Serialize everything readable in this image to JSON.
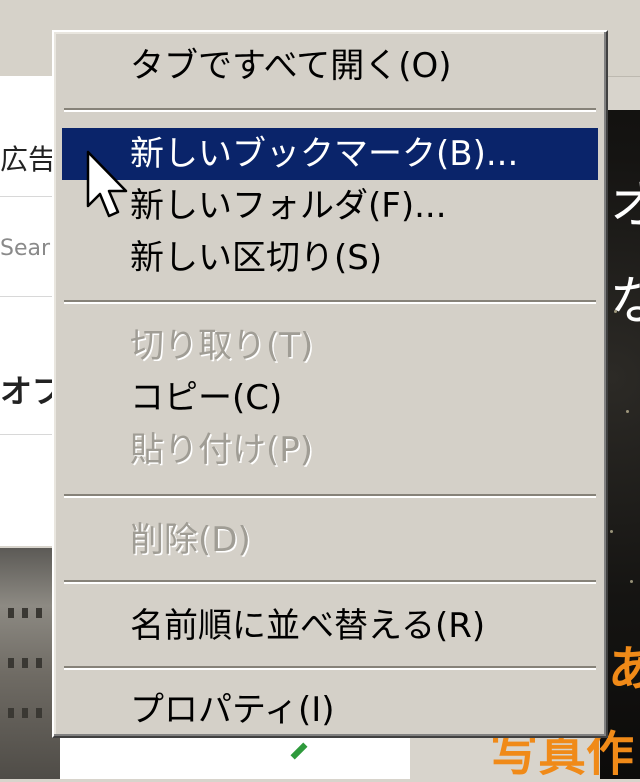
{
  "background": {
    "left_texts": [
      "広告は",
      "Sear",
      "オプ"
    ],
    "right_texts_white": [
      "オ",
      "な"
    ],
    "right_texts_orange": [
      "あ",
      "写真作"
    ]
  },
  "context_menu": {
    "items": [
      {
        "label": "タブですべて開く(O)",
        "state": "normal"
      },
      {
        "label": "新しいブックマーク(B)...",
        "state": "highlighted"
      },
      {
        "label": "新しいフォルダ(F)...",
        "state": "normal"
      },
      {
        "label": "新しい区切り(S)",
        "state": "normal"
      },
      {
        "label": "切り取り(T)",
        "state": "disabled"
      },
      {
        "label": "コピー(C)",
        "state": "normal"
      },
      {
        "label": "貼り付け(P)",
        "state": "disabled"
      },
      {
        "label": "削除(D)",
        "state": "disabled"
      },
      {
        "label": "名前順に並べ替える(R)",
        "state": "normal"
      },
      {
        "label": "プロパティ(I)",
        "state": "normal"
      }
    ]
  },
  "colors": {
    "menu_background": "#d4d0c8",
    "highlight": "#0a246a",
    "disabled_text": "#a09d95",
    "accent_orange": "#f08a18"
  },
  "icons": {
    "cursor": "mouse-pointer-icon"
  }
}
